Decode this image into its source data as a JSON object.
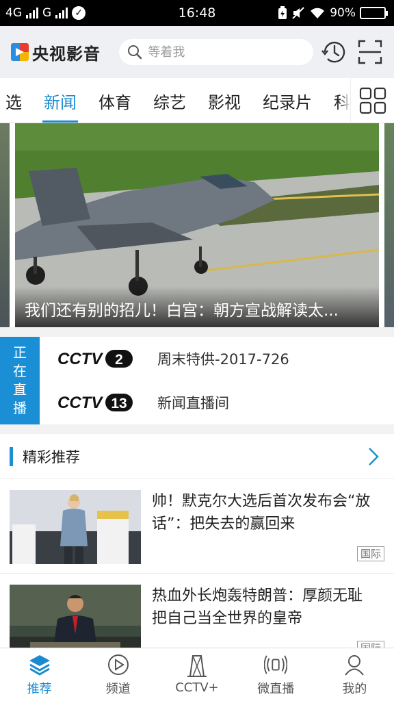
{
  "status_bar": {
    "network_1": "4G",
    "network_2": "G",
    "time": "16:48",
    "battery": "90%",
    "battery_level": 0.9
  },
  "header": {
    "logo_text": "央视影音",
    "search_placeholder": "等着我"
  },
  "tabs": [
    "选",
    "新闻",
    "体育",
    "综艺",
    "影视",
    "纪录片",
    "科"
  ],
  "active_tab": "新闻",
  "banner": {
    "caption": "我们还有别的招儿！白宫：朝方宣战解读太..."
  },
  "live": {
    "badge": [
      "正",
      "在",
      "直",
      "播"
    ],
    "channels": [
      {
        "logo_text": "CCTV",
        "number": "2",
        "program": "周末特供-2017-726"
      },
      {
        "logo_text": "CCTV",
        "number": "13",
        "program": "新闻直播间"
      }
    ]
  },
  "recommend": {
    "title": "精彩推荐",
    "items": [
      {
        "title": "帅！默克尔大选后首次发布会“放话”：把失去的赢回来",
        "tag": "国际"
      },
      {
        "title": "热血外长炮轰特朗普：厚颜无耻把自己当全世界的皇帝",
        "tag": "国际"
      }
    ]
  },
  "bottom_nav": [
    {
      "label": "推荐",
      "icon": "layers-icon",
      "active": true
    },
    {
      "label": "频道",
      "icon": "play-circle-icon",
      "active": false
    },
    {
      "label": "CCTV+",
      "icon": "tv-building-icon",
      "active": false
    },
    {
      "label": "微直播",
      "icon": "broadcast-icon",
      "active": false
    },
    {
      "label": "我的",
      "icon": "user-icon",
      "active": false
    }
  ],
  "colors": {
    "accent": "#1a8bd1",
    "live_badge": "#1b8fd6"
  }
}
